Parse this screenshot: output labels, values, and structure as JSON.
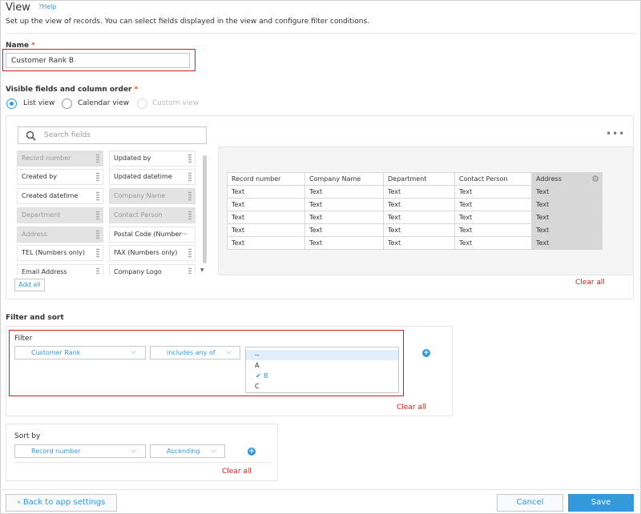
{
  "header": {
    "title": "View",
    "help_label": "?Help",
    "subtitle": "Set up the view of records. You can select fields displayed in the view and configure filter conditions."
  },
  "name_section": {
    "label": "Name",
    "required_mark": "*",
    "value": "Customer Rank B"
  },
  "visible_fields": {
    "label": "Visible fields and column order",
    "required_mark": "*",
    "view_options": [
      {
        "label": "List view",
        "selected": true,
        "disabled": false
      },
      {
        "label": "Calendar view",
        "selected": false,
        "disabled": false
      },
      {
        "label": "Custom view",
        "selected": false,
        "disabled": true
      }
    ],
    "search_placeholder": "Search fields",
    "fields": [
      {
        "label": "Record number",
        "used": true
      },
      {
        "label": "Updated by",
        "used": false
      },
      {
        "label": "Created by",
        "used": false
      },
      {
        "label": "Updated datetime",
        "used": false
      },
      {
        "label": "Created datetime",
        "used": false
      },
      {
        "label": "Company Name",
        "used": true
      },
      {
        "label": "Department",
        "used": true
      },
      {
        "label": "Contact Person",
        "used": true
      },
      {
        "label": "Address",
        "used": true
      },
      {
        "label": "Postal Code (Number···",
        "used": false
      },
      {
        "label": "TEL (Numbers only)",
        "used": false
      },
      {
        "label": "FAX (Numbers only)",
        "used": false
      },
      {
        "label": "Email Address",
        "used": false
      },
      {
        "label": "Company Logo",
        "used": false
      }
    ],
    "add_all_label": "Add all",
    "more_icon": "•••",
    "clear_all_label": "Clear all",
    "preview_columns": [
      "Record number",
      "Company Name",
      "Department",
      "Contact Person",
      "Address"
    ],
    "preview_rows": [
      [
        "Text",
        "Text",
        "Text",
        "Text",
        "Text"
      ],
      [
        "Text",
        "Text",
        "Text",
        "Text",
        "Text"
      ],
      [
        "Text",
        "Text",
        "Text",
        "Text",
        "Text"
      ],
      [
        "Text",
        "Text",
        "Text",
        "Text",
        "Text"
      ],
      [
        "Text",
        "Text",
        "Text",
        "Text",
        "Text"
      ]
    ]
  },
  "filter_sort": {
    "label": "Filter and sort",
    "filter": {
      "label": "Filter",
      "field_value": "Customer Rank",
      "operator_value": "includes any of",
      "options": [
        {
          "label": "--",
          "highlighted": true,
          "checked": false
        },
        {
          "label": "A",
          "highlighted": false,
          "checked": false
        },
        {
          "label": "B",
          "highlighted": false,
          "checked": true
        },
        {
          "label": "C",
          "highlighted": false,
          "checked": false
        }
      ],
      "clear_all_label": "Clear all"
    },
    "sort": {
      "label": "Sort by",
      "field_value": "Record number",
      "order_value": "Ascending",
      "clear_all_label": "Clear all"
    }
  },
  "footer": {
    "back_label": "Back to app settings",
    "cancel_label": "Cancel",
    "save_label": "Save"
  },
  "colors": {
    "accent": "#3498db",
    "danger": "#d11e1e",
    "highlight_box": "#d11e1e"
  }
}
